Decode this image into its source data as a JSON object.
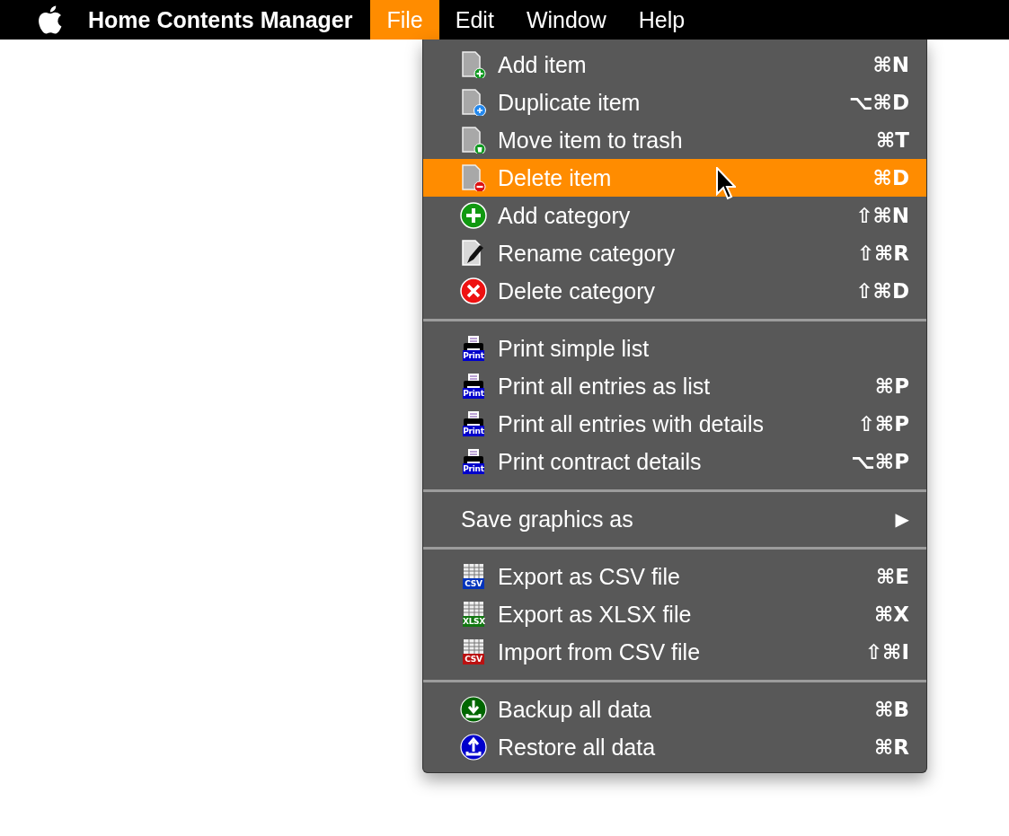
{
  "menu_bar": {
    "app_name": "Home Contents Manager",
    "menus": [
      {
        "label": "File",
        "selected": true
      },
      {
        "label": "Edit",
        "selected": false
      },
      {
        "label": "Window",
        "selected": false
      },
      {
        "label": "Help",
        "selected": false
      }
    ]
  },
  "file_menu": {
    "groups": [
      {
        "items": [
          {
            "label": "Add item",
            "shortcut": "⌘N",
            "kind": "doc-plus",
            "selected": false
          },
          {
            "label": "Duplicate item",
            "shortcut": "⌥⌘D",
            "kind": "doc-duplicate",
            "selected": false
          },
          {
            "label": "Move item to trash",
            "shortcut": "⌘T",
            "kind": "doc-trash",
            "selected": false
          },
          {
            "label": "Delete item",
            "shortcut": "⌘D",
            "kind": "doc-minus",
            "selected": true
          },
          {
            "label": "Add category",
            "shortcut": "⇧⌘N",
            "kind": "circle-plus",
            "selected": false
          },
          {
            "label": "Rename category",
            "shortcut": "⇧⌘R",
            "kind": "doc-pen",
            "selected": false
          },
          {
            "label": "Delete category",
            "shortcut": "⇧⌘D",
            "kind": "circle-x",
            "selected": false
          }
        ]
      },
      {
        "items": [
          {
            "label": "Print simple list",
            "kind": "printer",
            "badge": "Print",
            "color": "#0000cc",
            "selected": false
          },
          {
            "label": "Print all entries as list",
            "shortcut": "⌘P",
            "kind": "printer",
            "badge": "Print",
            "color": "#0000cc",
            "selected": false
          },
          {
            "label": "Print all entries with details",
            "shortcut": "⇧⌘P",
            "kind": "printer",
            "badge": "Print",
            "color": "#0000cc",
            "selected": false
          },
          {
            "label": "Print contract details",
            "shortcut": "⌥⌘P",
            "kind": "printer",
            "badge": "Print",
            "color": "#0000cc",
            "selected": false
          }
        ]
      },
      {
        "items": [
          {
            "label": "Save graphics as",
            "arrow": "▶",
            "selected": false
          }
        ]
      },
      {
        "items": [
          {
            "label": "Export as CSV file",
            "shortcut": "⌘E",
            "kind": "table",
            "badge": "CSV",
            "color": "#0033bb",
            "selected": false
          },
          {
            "label": "Export as XLSX file",
            "shortcut": "⌘X",
            "kind": "table",
            "badge": "XLSX",
            "color": "#117711",
            "selected": false
          },
          {
            "label": "Import from CSV file",
            "shortcut": "⇧⌘I",
            "kind": "table",
            "badge": "CSV",
            "color": "#bb1111",
            "selected": false
          }
        ]
      },
      {
        "items": [
          {
            "label": "Backup all data",
            "shortcut": "⌘B",
            "kind": "circle-down",
            "selected": false
          },
          {
            "label": "Restore all data",
            "shortcut": "⌘R",
            "kind": "circle-up",
            "selected": false
          }
        ]
      }
    ]
  }
}
